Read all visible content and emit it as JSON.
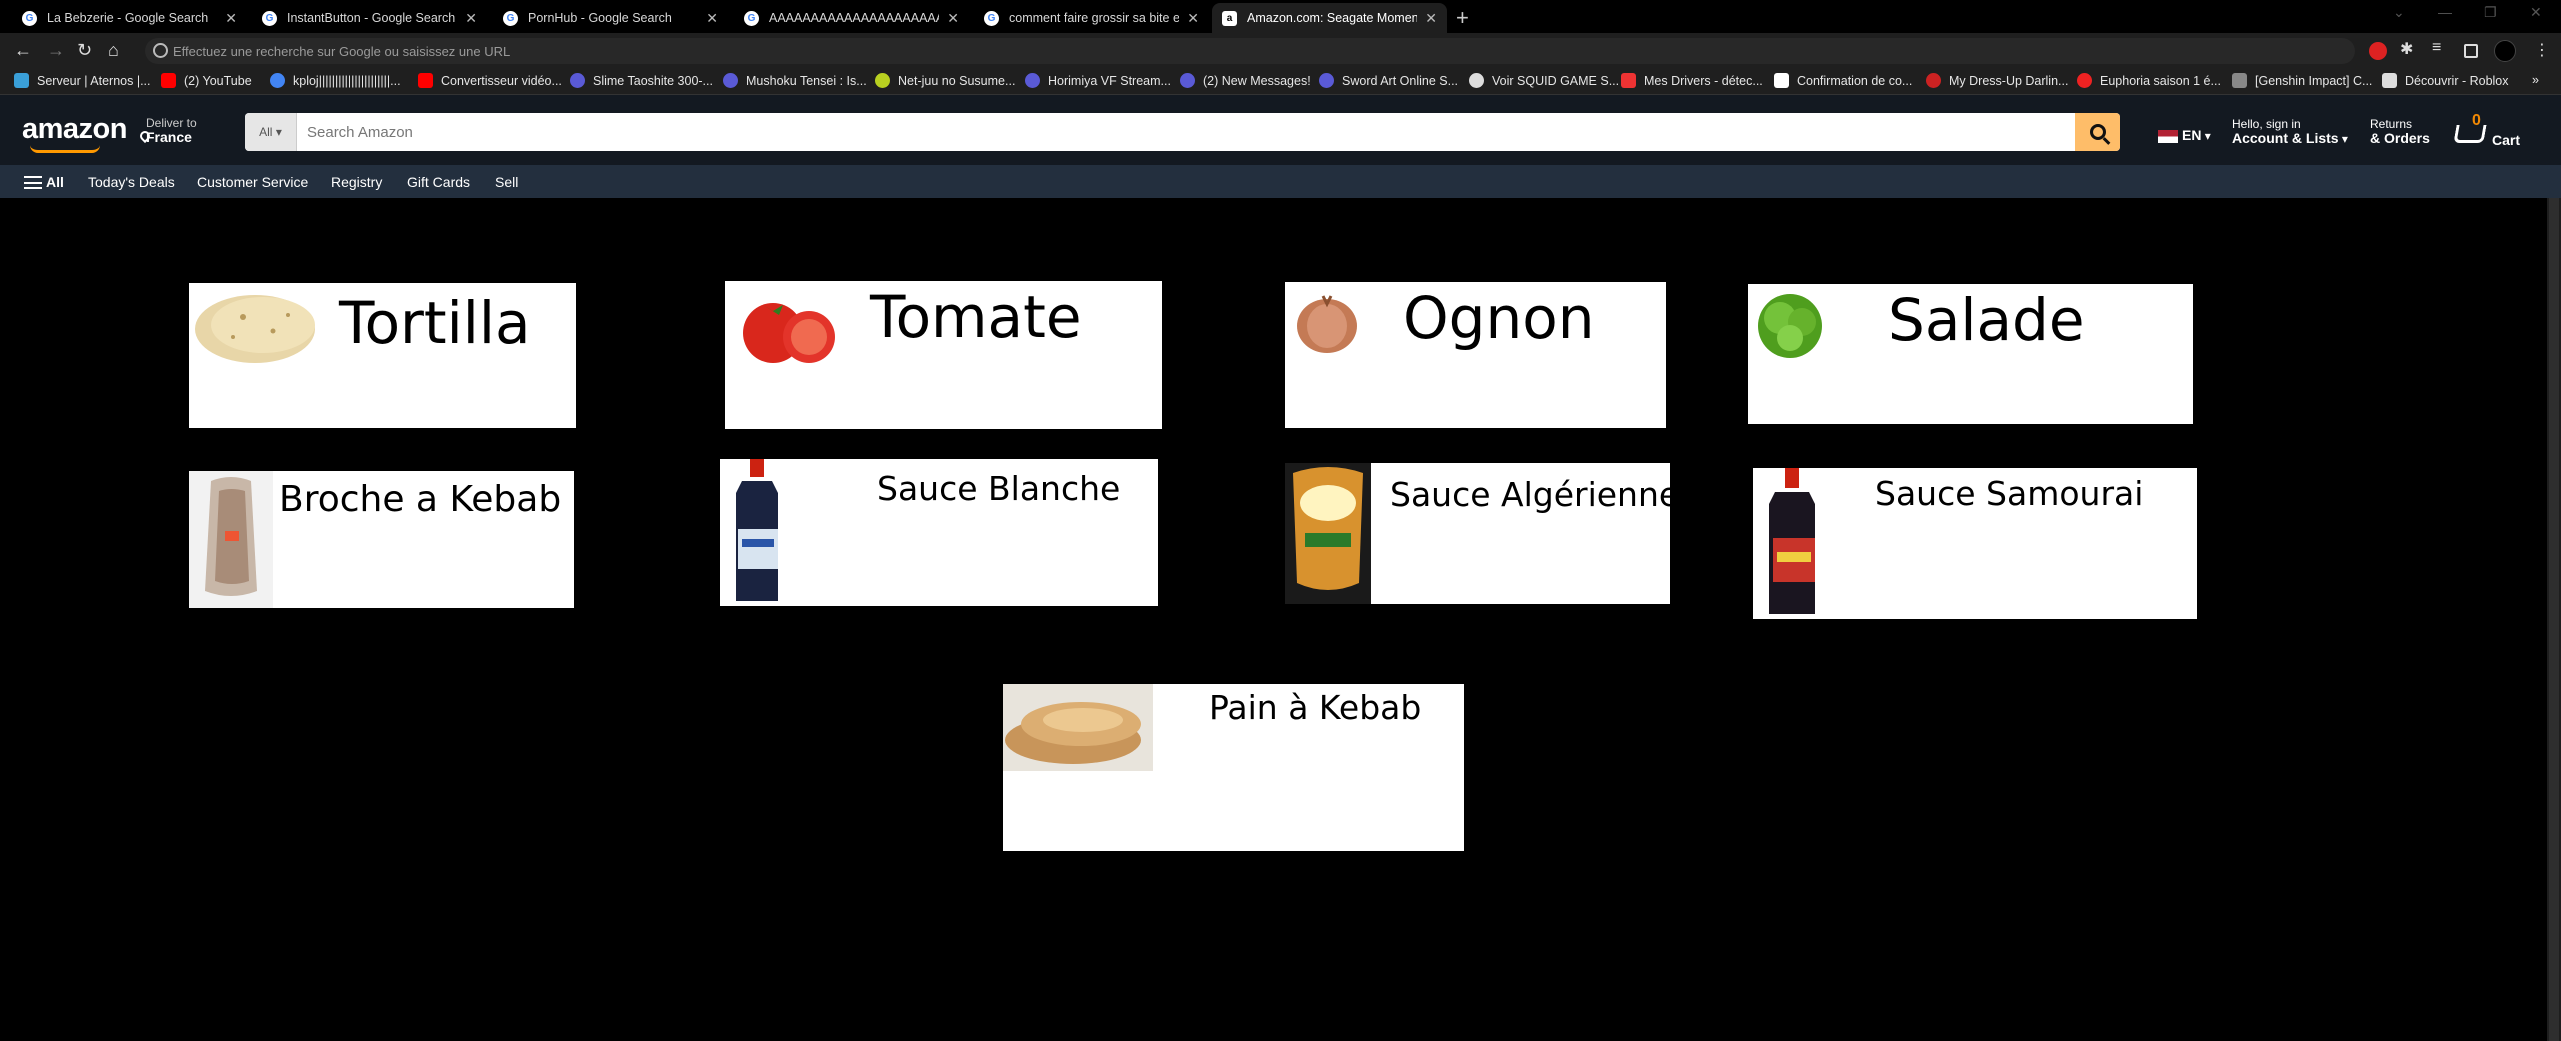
{
  "tabs": [
    {
      "title": "La Bebzerie - Google Search"
    },
    {
      "title": "InstantButton - Google Search"
    },
    {
      "title": "PornHub - Google Search"
    },
    {
      "title": "AAAAAAAAAAAAAAAAAAAAAAAA"
    },
    {
      "title": "comment faire grossir sa bite ell"
    },
    {
      "title": "Amazon.com: Seagate Momentu",
      "active": true
    }
  ],
  "new_tab_label": "+",
  "omnibox": {
    "placeholder": "Effectuez une recherche sur Google ou saisissez une URL"
  },
  "bookmarks": [
    {
      "label": "Serveur | Aternos |..."
    },
    {
      "label": "(2) YouTube"
    },
    {
      "label": "kploj||||||||||||||||||||||..."
    },
    {
      "label": "Convertisseur vidéo..."
    },
    {
      "label": "Slime Taoshite 300-..."
    },
    {
      "label": "Mushoku Tensei : Is..."
    },
    {
      "label": "Net-juu no Susume..."
    },
    {
      "label": "Horimiya VF Stream..."
    },
    {
      "label": "(2) New Messages!"
    },
    {
      "label": "Sword Art Online S..."
    },
    {
      "label": "Voir SQUID GAME S..."
    },
    {
      "label": "Mes Drivers - détec..."
    },
    {
      "label": "Confirmation de co..."
    },
    {
      "label": "My Dress-Up Darlin..."
    },
    {
      "label": "Euphoria saison 1 é..."
    },
    {
      "label": "[Genshin Impact] C..."
    },
    {
      "label": "Découvrir - Roblox"
    }
  ],
  "amazon": {
    "logo": "amazon",
    "deliver_to": "Deliver to",
    "deliver_country": "France",
    "search_category": "All",
    "search_placeholder": "Search Amazon",
    "language": "EN",
    "account_line1": "Hello, sign in",
    "account_line2": "Account & Lists",
    "returns_line1": "Returns",
    "returns_line2": "& Orders",
    "cart_count": "0",
    "cart_label": "Cart",
    "subnav": [
      "All",
      "Today's Deals",
      "Customer Service",
      "Registry",
      "Gift Cards",
      "Sell"
    ]
  },
  "ingredients": [
    {
      "label": "Tortilla"
    },
    {
      "label": "Tomate"
    },
    {
      "label": "Ognon"
    },
    {
      "label": "Salade"
    },
    {
      "label": "Broche a Kebab"
    },
    {
      "label": "Sauce Blanche"
    },
    {
      "label": "Sauce Algérienne"
    },
    {
      "label": "Sauce Samourai"
    },
    {
      "label": "Pain à Kebab"
    }
  ],
  "colors": {
    "amazon_header": "#131921",
    "amazon_subnav": "#232f3e",
    "search_button": "#febd69",
    "page_background": "#000000"
  }
}
